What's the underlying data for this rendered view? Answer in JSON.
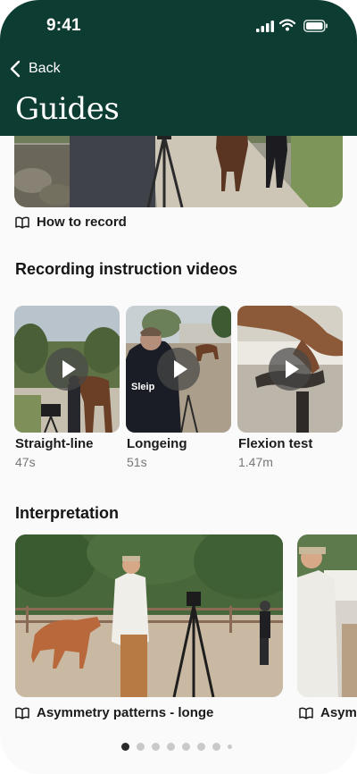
{
  "status_bar": {
    "time": "9:41"
  },
  "nav": {
    "back_label": "Back",
    "title": "Guides"
  },
  "how_to_record": {
    "label": "How to record"
  },
  "recording_section": {
    "title": "Recording instruction videos",
    "videos": [
      {
        "label": "Straight-line",
        "duration": "47s"
      },
      {
        "label": "Longeing",
        "duration": "51s"
      },
      {
        "label": "Flexion test",
        "duration": "1.47m"
      }
    ]
  },
  "interpretation_section": {
    "title": "Interpretation",
    "cards": [
      {
        "label": "Asymmetry patterns - longe"
      },
      {
        "label": "Asym"
      }
    ]
  },
  "icons": {
    "back": "chevron-left-icon",
    "guide": "book-open-icon",
    "play": "play-icon",
    "signal": "signal-icon",
    "wifi": "wifi-icon",
    "battery": "battery-icon"
  },
  "colors": {
    "header": "#0d3c32",
    "text": "#1b1b1b",
    "muted": "#777777"
  },
  "pagination": {
    "pages": 8,
    "active": 1
  }
}
